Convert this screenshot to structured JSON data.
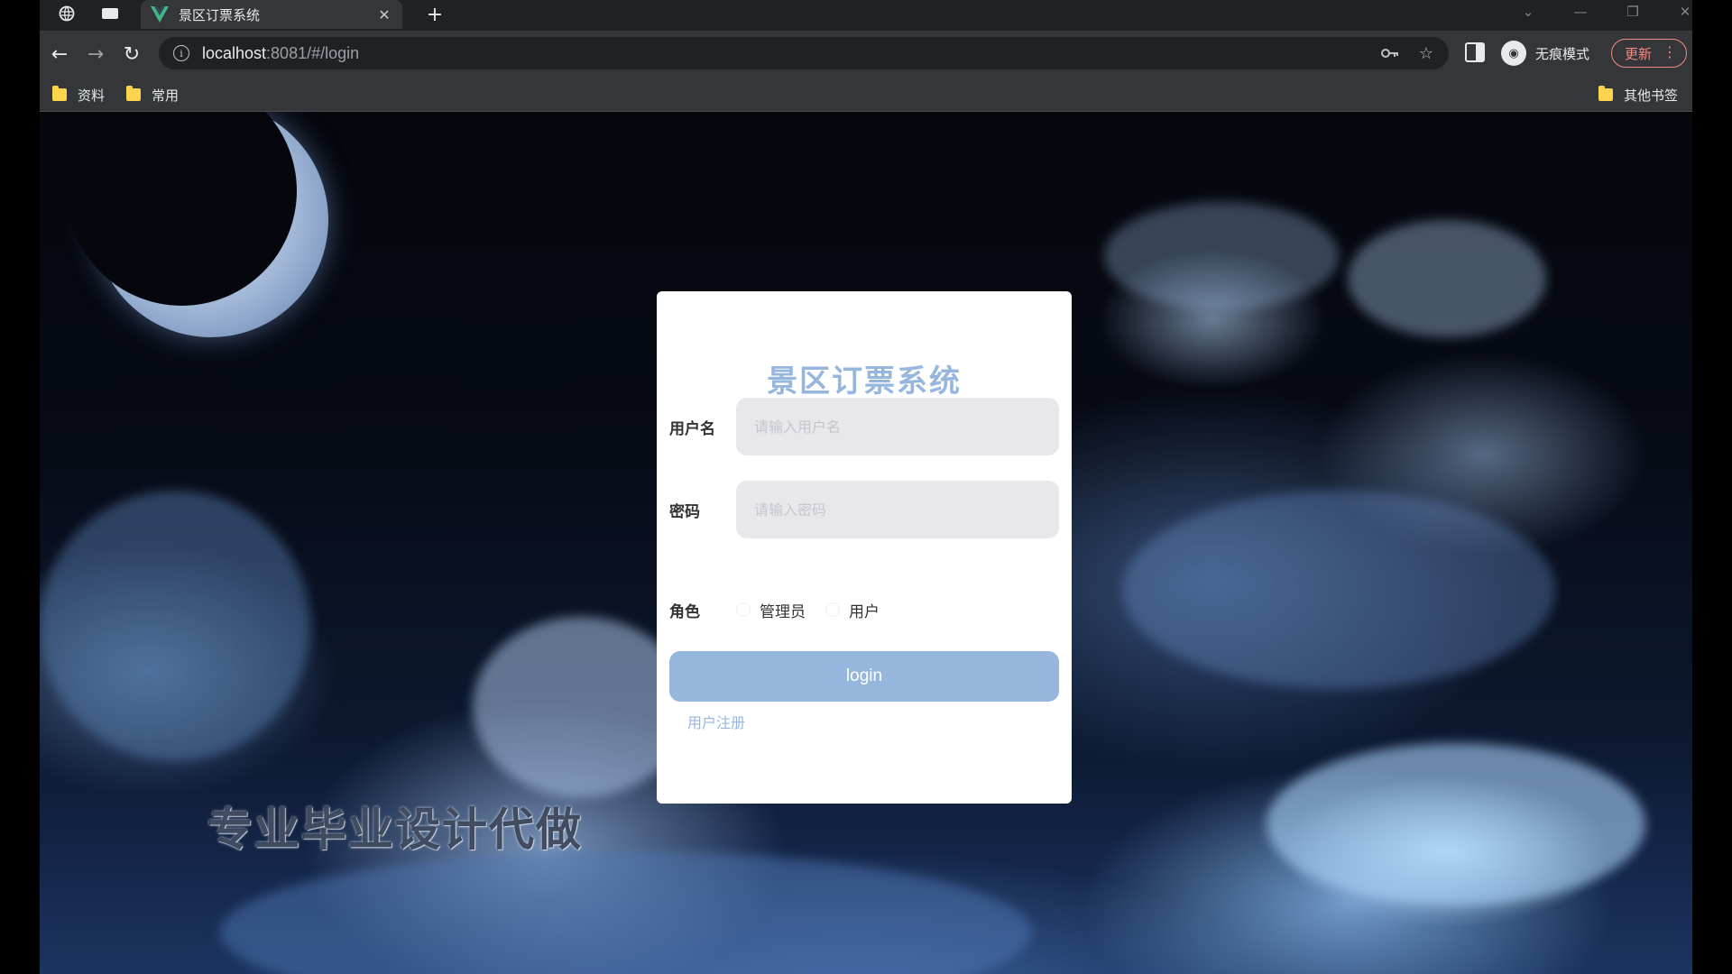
{
  "browser": {
    "tab_title": "景区订票系统",
    "url_host": "localhost",
    "url_rest": ":8081/#/login",
    "incognito_label": "无痕模式",
    "update_label": "更新",
    "bookmarks": [
      "资料",
      "常用"
    ],
    "other_bookmarks": "其他书签"
  },
  "login": {
    "title": "景区订票系统",
    "username_label": "用户名",
    "username_placeholder": "请输入用户名",
    "password_label": "密码",
    "password_placeholder": "请输入密码",
    "role_label": "角色",
    "roles": [
      "管理员",
      "用户"
    ],
    "login_button": "login",
    "register_link": "用户注册"
  },
  "overlay": {
    "watermark": "专业毕业设计代做"
  },
  "colors": {
    "accent": "#97b6dd",
    "browser_dark": "#202124",
    "toolbar": "#35363a",
    "update_red": "#f28b82"
  }
}
